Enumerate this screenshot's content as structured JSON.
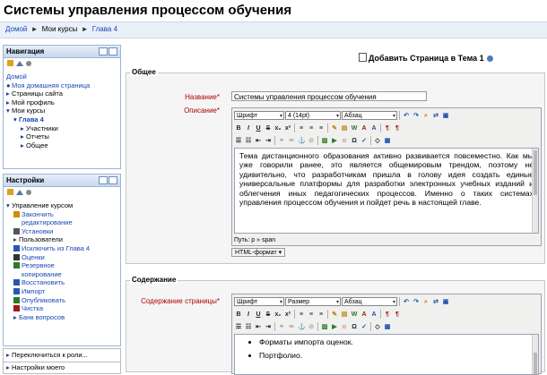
{
  "page": {
    "title": "Системы управления процессом обучения"
  },
  "breadcrumb": {
    "items": [
      "Домой",
      "Мои курсы",
      "Глава 4"
    ],
    "separator": "►"
  },
  "navigation": {
    "title": "Навигация",
    "items": [
      {
        "label": "Домой",
        "level": 0,
        "link": true,
        "bullet": ""
      },
      {
        "label": "Моя домашняя страница",
        "level": 0,
        "link": true,
        "bullet": "●"
      },
      {
        "label": "Страницы сайта",
        "level": 0,
        "link": false,
        "bullet": "▸"
      },
      {
        "label": "Мой профиль",
        "level": 0,
        "link": false,
        "bullet": "▸"
      },
      {
        "label": "Мои курсы",
        "level": 0,
        "link": false,
        "bullet": "▾"
      },
      {
        "label": "Глава 4",
        "level": 1,
        "link": true,
        "bullet": "▾"
      },
      {
        "label": "Участники",
        "level": 2,
        "link": false,
        "bullet": "▸"
      },
      {
        "label": "Отчеты",
        "level": 2,
        "link": false,
        "bullet": "▸"
      },
      {
        "label": "Общее",
        "level": 2,
        "link": false,
        "bullet": "▸"
      }
    ]
  },
  "settings": {
    "title": "Настройки",
    "items": [
      {
        "label": "Управление курсом",
        "level": 0,
        "link": false,
        "icon": "▾"
      },
      {
        "label": "Закончить",
        "level": 1,
        "link": true,
        "icon": "pencil-icon"
      },
      {
        "label": "редактирование",
        "level": 1,
        "link": true,
        "icon": ""
      },
      {
        "label": "Установки",
        "level": 1,
        "link": true,
        "icon": "settings-icon"
      },
      {
        "label": "Пользователи",
        "level": 1,
        "link": false,
        "icon": "▸"
      },
      {
        "label": "Исключить из Глава 4",
        "level": 1,
        "link": true,
        "icon": "unenrol-icon"
      },
      {
        "label": "Оценки",
        "level": 1,
        "link": true,
        "icon": "grades-icon"
      },
      {
        "label": "Резервное",
        "level": 1,
        "link": true,
        "icon": "backup-icon"
      },
      {
        "label": "копирование",
        "level": 1,
        "link": true,
        "icon": ""
      },
      {
        "label": "Восстановить",
        "level": 1,
        "link": true,
        "icon": "restore-icon"
      },
      {
        "label": "Импорт",
        "level": 1,
        "link": true,
        "icon": "import-icon"
      },
      {
        "label": "Опубликовать",
        "level": 1,
        "link": true,
        "icon": "publish-icon"
      },
      {
        "label": "Чистка",
        "level": 1,
        "link": true,
        "icon": "reset-icon"
      },
      {
        "label": "Банк вопросов",
        "level": 1,
        "link": true,
        "icon": "▸"
      }
    ],
    "switch_role": "Переключиться к роли...",
    "my_profile_settings": "Настройки моего"
  },
  "main": {
    "add_heading": "Добавить Страница в Тема 1",
    "general": {
      "legend": "Общее",
      "name_label": "Название",
      "name_value": "Системы управления процессом обучения",
      "description_label": "Описание",
      "font_select": "Шрифт",
      "size_select": "4 (14pt)",
      "para_select": "Абзац",
      "content": "Тема дистанционного образования активно развивается повсеместно. Как мы уже говорили ранее, это является общемировым трендом, поэтому не удивительно, что разработчикам пришла в голову идея создать единые универсальные платформы для разработки электронных учебных изданий и облегчения иных педагогических процессов. Именно о таких системах управления процессом обучения и пойдет речь в настоящей главе.",
      "path": "Путь: p » span",
      "format": "HTML-формат ▾"
    },
    "content_section": {
      "legend": "Содержание",
      "content_label": "Содержание страницы",
      "font_select": "Шрифт",
      "size_select": "Размер",
      "para_select": "Абзац",
      "bullets": [
        "Форматы импорта оценок.",
        "Портфолио."
      ]
    },
    "required_marker": "*"
  },
  "colors": {
    "link": "#1a46b8",
    "required": "#b00000",
    "block_border": "#9db4d6"
  }
}
